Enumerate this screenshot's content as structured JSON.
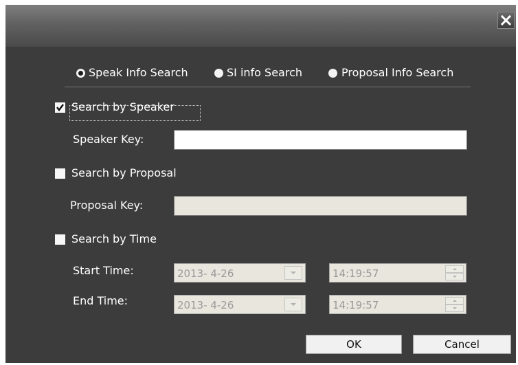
{
  "titlebar": {
    "close_glyph": "✕",
    "close_icon": "close-icon"
  },
  "search_type": {
    "options": [
      {
        "label": "Speak Info Search",
        "selected": true
      },
      {
        "label": "SI info Search",
        "selected": false
      },
      {
        "label": "Proposal Info Search",
        "selected": false
      }
    ]
  },
  "speaker": {
    "checkbox_label": "Search by Speaker",
    "checked": true,
    "key_label": "Speaker Key:",
    "key_value": ""
  },
  "proposal": {
    "checkbox_label": "Search by Proposal",
    "checked": false,
    "key_label": "Proposal Key:",
    "key_value": ""
  },
  "time": {
    "checkbox_label": "Search by Time",
    "checked": false,
    "start_label": "Start Time:",
    "start_date": "2013-  4-26",
    "start_time": "14:19:57",
    "end_label": "End Time:",
    "end_date": "2013-  4-26",
    "end_time": "14:19:57"
  },
  "buttons": {
    "ok": "OK",
    "cancel": "Cancel"
  },
  "colors": {
    "dialog_bg": "#3c3c3c",
    "titlebar": "#616161",
    "text": "#ffffff",
    "disabled_field": "#e8e6dd"
  }
}
